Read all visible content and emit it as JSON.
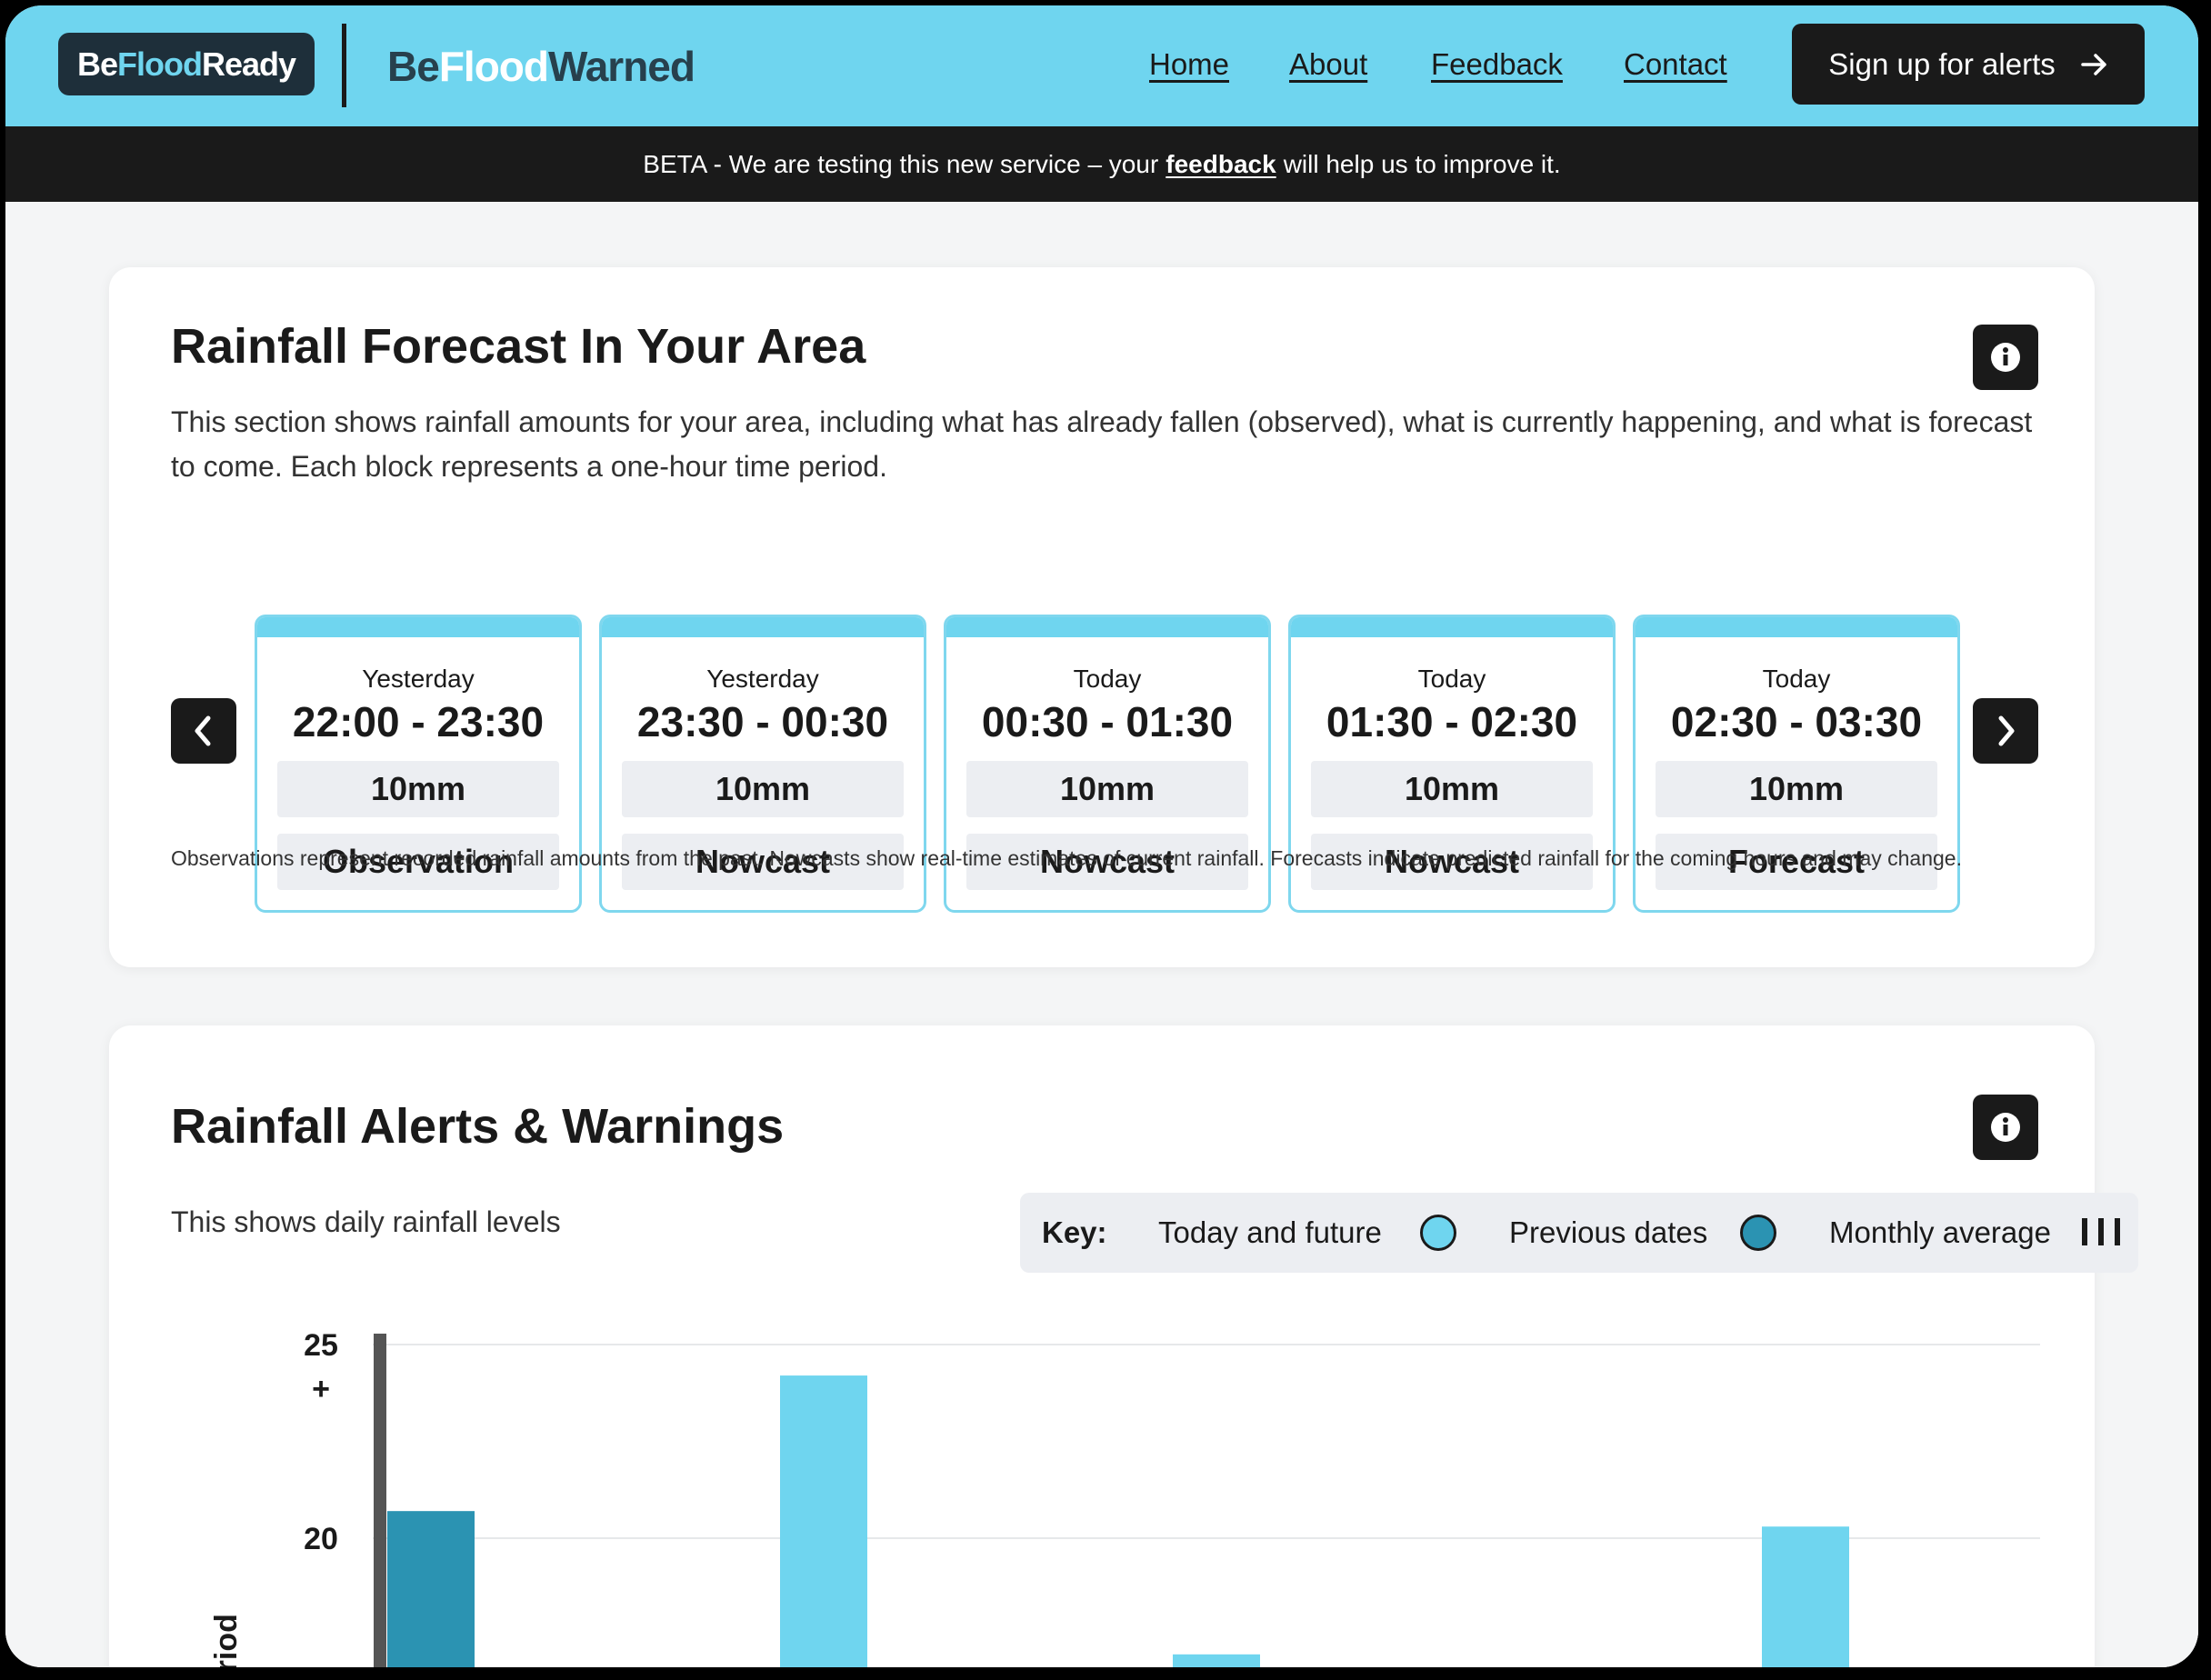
{
  "header": {
    "logo_ready": {
      "be": "Be",
      "flood": "Flood",
      "ready": "Ready"
    },
    "logo_warned": {
      "be": "Be",
      "flood": "Flood",
      "warned": "Warned"
    },
    "nav": [
      {
        "label": "Home"
      },
      {
        "label": "About"
      },
      {
        "label": "Feedback"
      },
      {
        "label": "Contact"
      }
    ],
    "signup_label": "Sign up for alerts",
    "signup_icon": "arrow-right-icon"
  },
  "beta": {
    "prefix": "BETA - We are testing this new service – your",
    "link": "feedback",
    "suffix": "will help us to improve it."
  },
  "forecast": {
    "title": "Rainfall Forecast In Your Area",
    "info_icon": "info-icon",
    "description": "This section shows rainfall amounts for your area, including what has already fallen (observed), what is currently happening, and what is forecast to come. Each block represents a one-hour time period.",
    "slots": [
      {
        "day": "Yesterday",
        "time": "22:00 - 23:30",
        "amount": "10mm",
        "kind": "Observation"
      },
      {
        "day": "Yesterday",
        "time": "23:30 - 00:30",
        "amount": "10mm",
        "kind": "Nowcast"
      },
      {
        "day": "Today",
        "time": "00:30 - 01:30",
        "amount": "10mm",
        "kind": "Nowcast"
      },
      {
        "day": "Today",
        "time": "01:30 - 02:30",
        "amount": "10mm",
        "kind": "Nowcast"
      },
      {
        "day": "Today",
        "time": "02:30 - 03:30",
        "amount": "10mm",
        "kind": "Forecast"
      }
    ],
    "footnote": "Observations represent recorded rainfall amounts from the past. Nowcasts show real-time estimates of current rainfall. Forecasts indicate predicted rainfall for the coming hours and may change."
  },
  "alerts": {
    "title": "Rainfall Alerts & Warnings",
    "info_icon": "info-icon",
    "subtitle": "This shows daily rainfall levels",
    "key": {
      "label": "Key:",
      "today": "Today and future",
      "previous": "Previous dates",
      "average": "Monthly average"
    },
    "colors": {
      "today": "#6fd5ef",
      "previous": "#2b93b2",
      "average": "#555555"
    }
  },
  "chart_data": {
    "type": "bar",
    "ylabel": "Period",
    "yticks": [
      "20",
      "25 +"
    ],
    "ylim_visible": [
      15.5,
      25
    ],
    "monthly_average": 25,
    "series": [
      {
        "name": "Previous dates",
        "points": [
          {
            "slot": 0,
            "value": 20.7
          }
        ]
      },
      {
        "name": "Today and future",
        "points": [
          {
            "slot": 1,
            "value": 24.2
          },
          {
            "slot": 2,
            "value": 17
          },
          {
            "slot": 3,
            "value": 20.3
          }
        ]
      }
    ]
  }
}
